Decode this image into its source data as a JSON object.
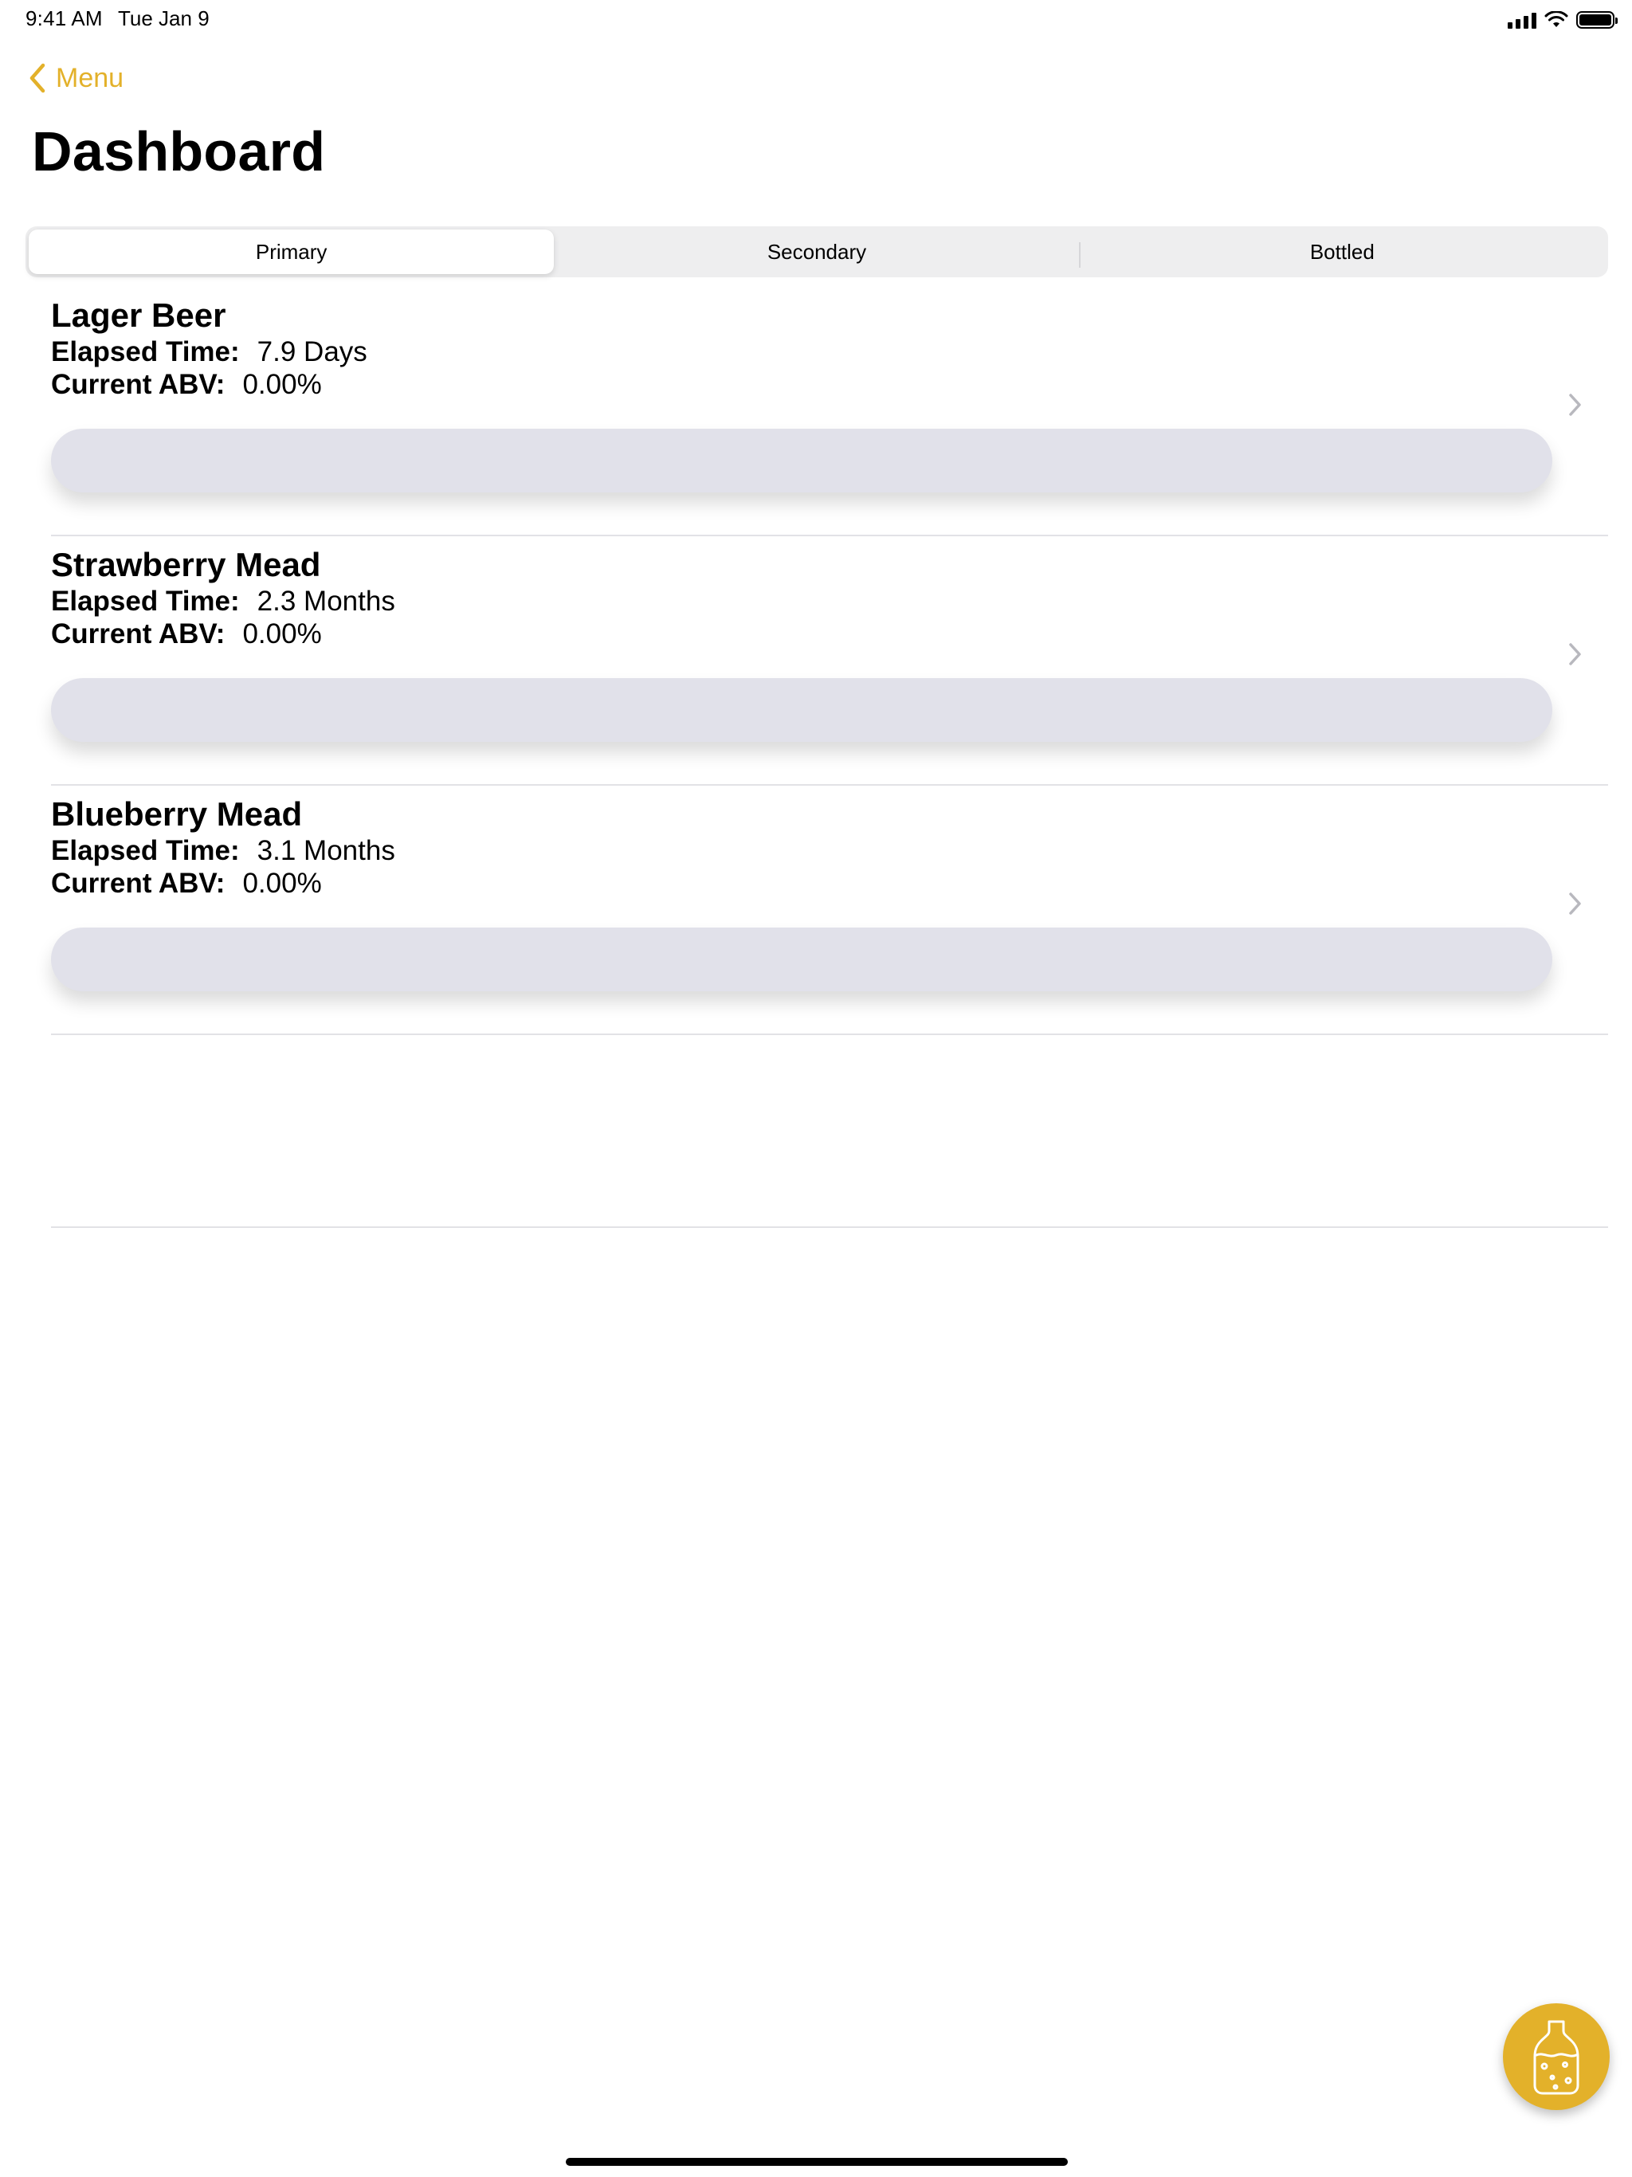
{
  "status_bar": {
    "time": "9:41 AM",
    "date": "Tue Jan 9",
    "icons": [
      "cellular-signal-icon",
      "wifi-icon",
      "battery-icon"
    ]
  },
  "nav": {
    "back_label": "Menu",
    "back_icon": "chevron-left-icon",
    "title": "Dashboard"
  },
  "segments": {
    "items": [
      "Primary",
      "Secondary",
      "Bottled"
    ],
    "selected": "Primary"
  },
  "batches": [
    {
      "name": "Lager Beer",
      "elapsed_label": "Elapsed Time:",
      "elapsed_value": "7.9 Days",
      "abv_label": "Current ABV:",
      "abv_value": "0.00%",
      "progress": 0.0
    },
    {
      "name": "Strawberry Mead",
      "elapsed_label": "Elapsed Time:",
      "elapsed_value": "2.3 Months",
      "abv_label": "Current ABV:",
      "abv_value": "0.00%",
      "progress": 0.0
    },
    {
      "name": "Blueberry Mead",
      "elapsed_label": "Elapsed Time:",
      "elapsed_value": "3.1 Months",
      "abv_label": "Current ABV:",
      "abv_value": "0.00%",
      "progress": 0.0
    }
  ],
  "fab": {
    "icon": "fermenter-jug-icon"
  },
  "colors": {
    "accent": "#E3B12A",
    "progress_track": "#E1E1EA",
    "separator": "#E2E2E6"
  }
}
